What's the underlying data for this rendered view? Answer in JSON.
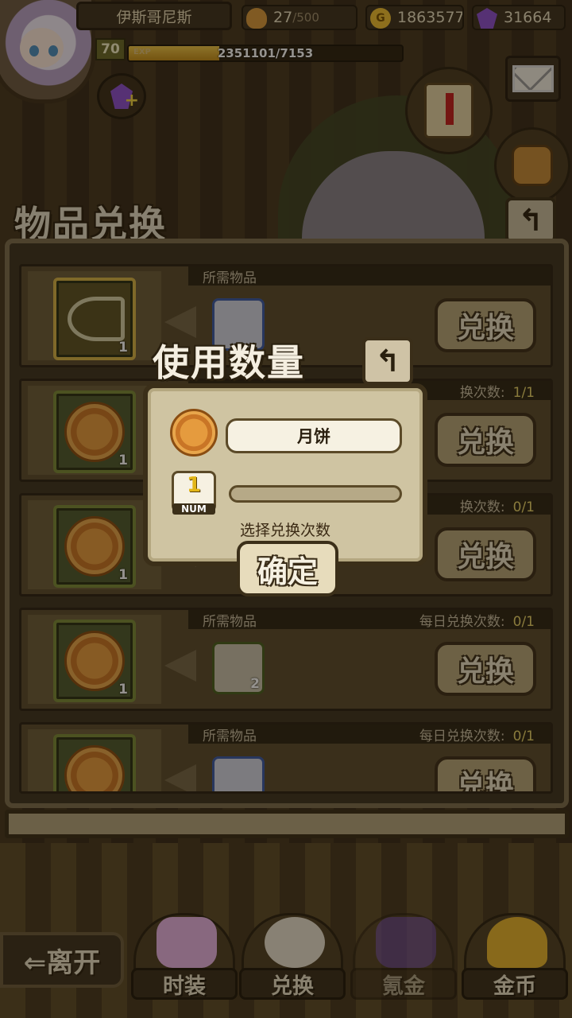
{
  "player": {
    "name": "伊斯哥尼斯",
    "level": "70",
    "exp_label": "EXP",
    "exp_text": "2351101/7153",
    "exp_fraction": 0.33
  },
  "resources": {
    "stamina": "27",
    "stamina_max": "/500",
    "gold_symbol": "G",
    "gold": "1863577",
    "gems": "31664"
  },
  "section_title": "物品兑换",
  "back_symbol": "↰",
  "rows": [
    {
      "req_header": "所需物品",
      "count_label": "",
      "count_value": "",
      "item_qty": "1",
      "req_qty": "",
      "button": "兑换"
    },
    {
      "req_header": "",
      "count_label": "换次数:",
      "count_value": "1/1",
      "item_qty": "1",
      "req_qty": "",
      "button": "兑换"
    },
    {
      "req_header": "",
      "count_label": "换次数:",
      "count_value": "0/1",
      "item_qty": "1",
      "req_qty": "",
      "button": "兑换"
    },
    {
      "req_header": "所需物品",
      "count_label": "每日兑换次数:",
      "count_value": "0/1",
      "item_qty": "1",
      "req_qty": "2",
      "button": "兑换"
    },
    {
      "req_header": "所需物品",
      "count_label": "每日兑换次数:",
      "count_value": "0/1",
      "item_qty": "",
      "req_qty": "",
      "button": "兑换"
    }
  ],
  "dialog": {
    "title": "使用数量",
    "item_name": "月饼",
    "count": "1",
    "count_tag": "NUM",
    "hint": "选择兑换次数",
    "confirm": "确定"
  },
  "nav": {
    "leave": "⇐离开",
    "tabs": [
      "时装",
      "兑换",
      "氪金",
      "金币"
    ]
  }
}
